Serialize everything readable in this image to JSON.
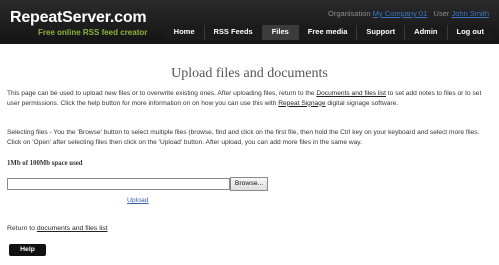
{
  "header": {
    "logo": "RepeatServer.com",
    "tagline": "Free online RSS feed creator",
    "org_label": "Organisation",
    "org_value": "My Company 01",
    "user_label": "User",
    "user_value": "John Smith",
    "nav": [
      "Home",
      "RSS Feeds",
      "Files",
      "Free media",
      "Support",
      "Admin",
      "Log out"
    ]
  },
  "main": {
    "title": "Upload files and documents",
    "intro": {
      "part1": "This page can be used to upload new files or to overwrite existing ones.  After uploading files, return to the ",
      "link1": "Documents and files list",
      "part2": " to set add notes to files or to set user permissions.  Click the help button for more information on on how you can use this with ",
      "link2": "Repeat Signage",
      "part3": " digital signage software."
    },
    "instructions": "Selecting files - You the 'Browse' button to select multiple files (browse, find and click on the first file, then hold the Ctrl key on your keyboard and select more files.  Click on 'Open' after selecting files then click on the 'Upload' button.  After upload, you can add more files in the same way.",
    "space_used": "1Mb of 100Mb space used",
    "file_input_value": "",
    "browse_label": "Browse...",
    "upload_label": "Upload",
    "return_prefix": "Return to ",
    "return_link": "documents and files list",
    "help_label": "Help"
  }
}
